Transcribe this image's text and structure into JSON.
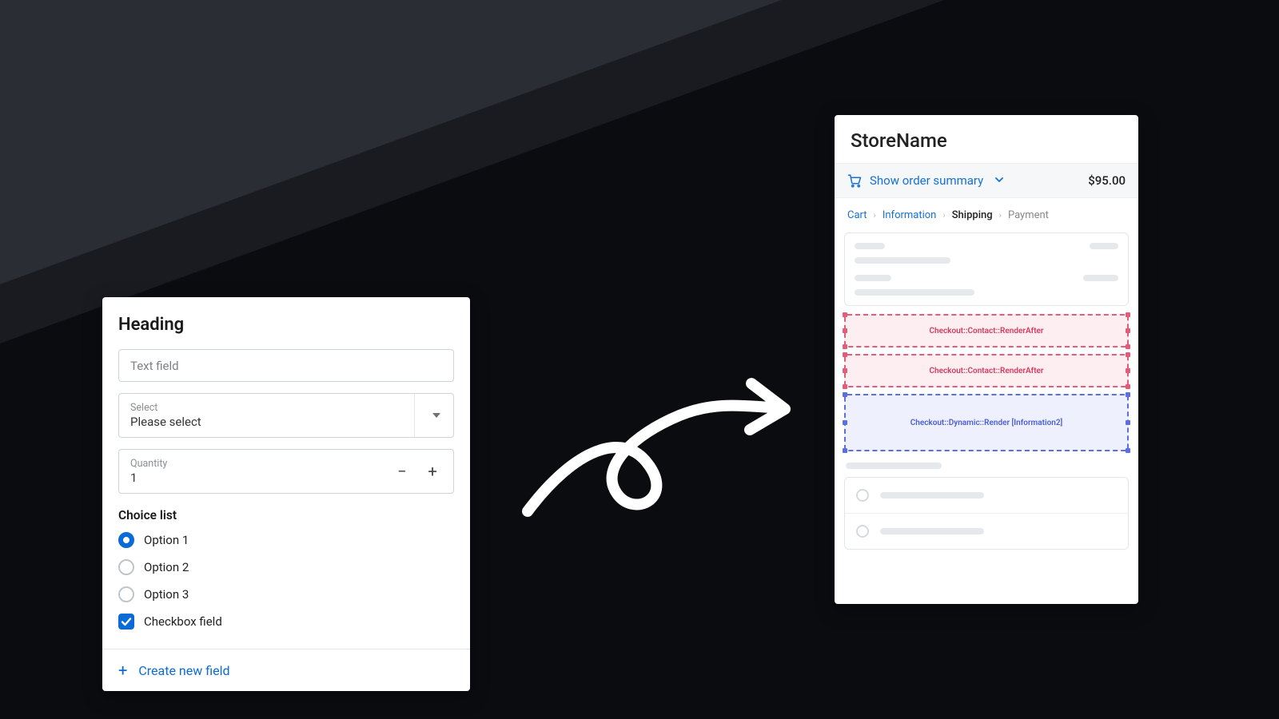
{
  "form": {
    "heading": "Heading",
    "text_placeholder": "Text field",
    "select_label": "Select",
    "select_value": "Please select",
    "quantity_label": "Quantity",
    "quantity_value": "1",
    "choice_title": "Choice list",
    "options": [
      "Option 1",
      "Option 2",
      "Option 3"
    ],
    "selected_option_index": 0,
    "checkbox_label": "Checkbox field",
    "checkbox_checked": true,
    "create_field_label": "Create new field"
  },
  "checkout": {
    "store_name": "StoreName",
    "summary_toggle": "Show order summary",
    "order_total": "$95.00",
    "breadcrumb": {
      "cart": "Cart",
      "information": "Information",
      "shipping": "Shipping",
      "payment": "Payment"
    },
    "extension_points": {
      "contact_render_after_1": "Checkout::Contact::RenderAfter",
      "contact_render_after_2": "Checkout::Contact::RenderAfter",
      "dynamic_render": "Checkout::Dynamic::Render [Information2]"
    }
  },
  "colors": {
    "link": "#1571d6",
    "accent": "#0a6bd6",
    "ext_red": "#e35d7a",
    "ext_blue": "#5b6fe0"
  }
}
